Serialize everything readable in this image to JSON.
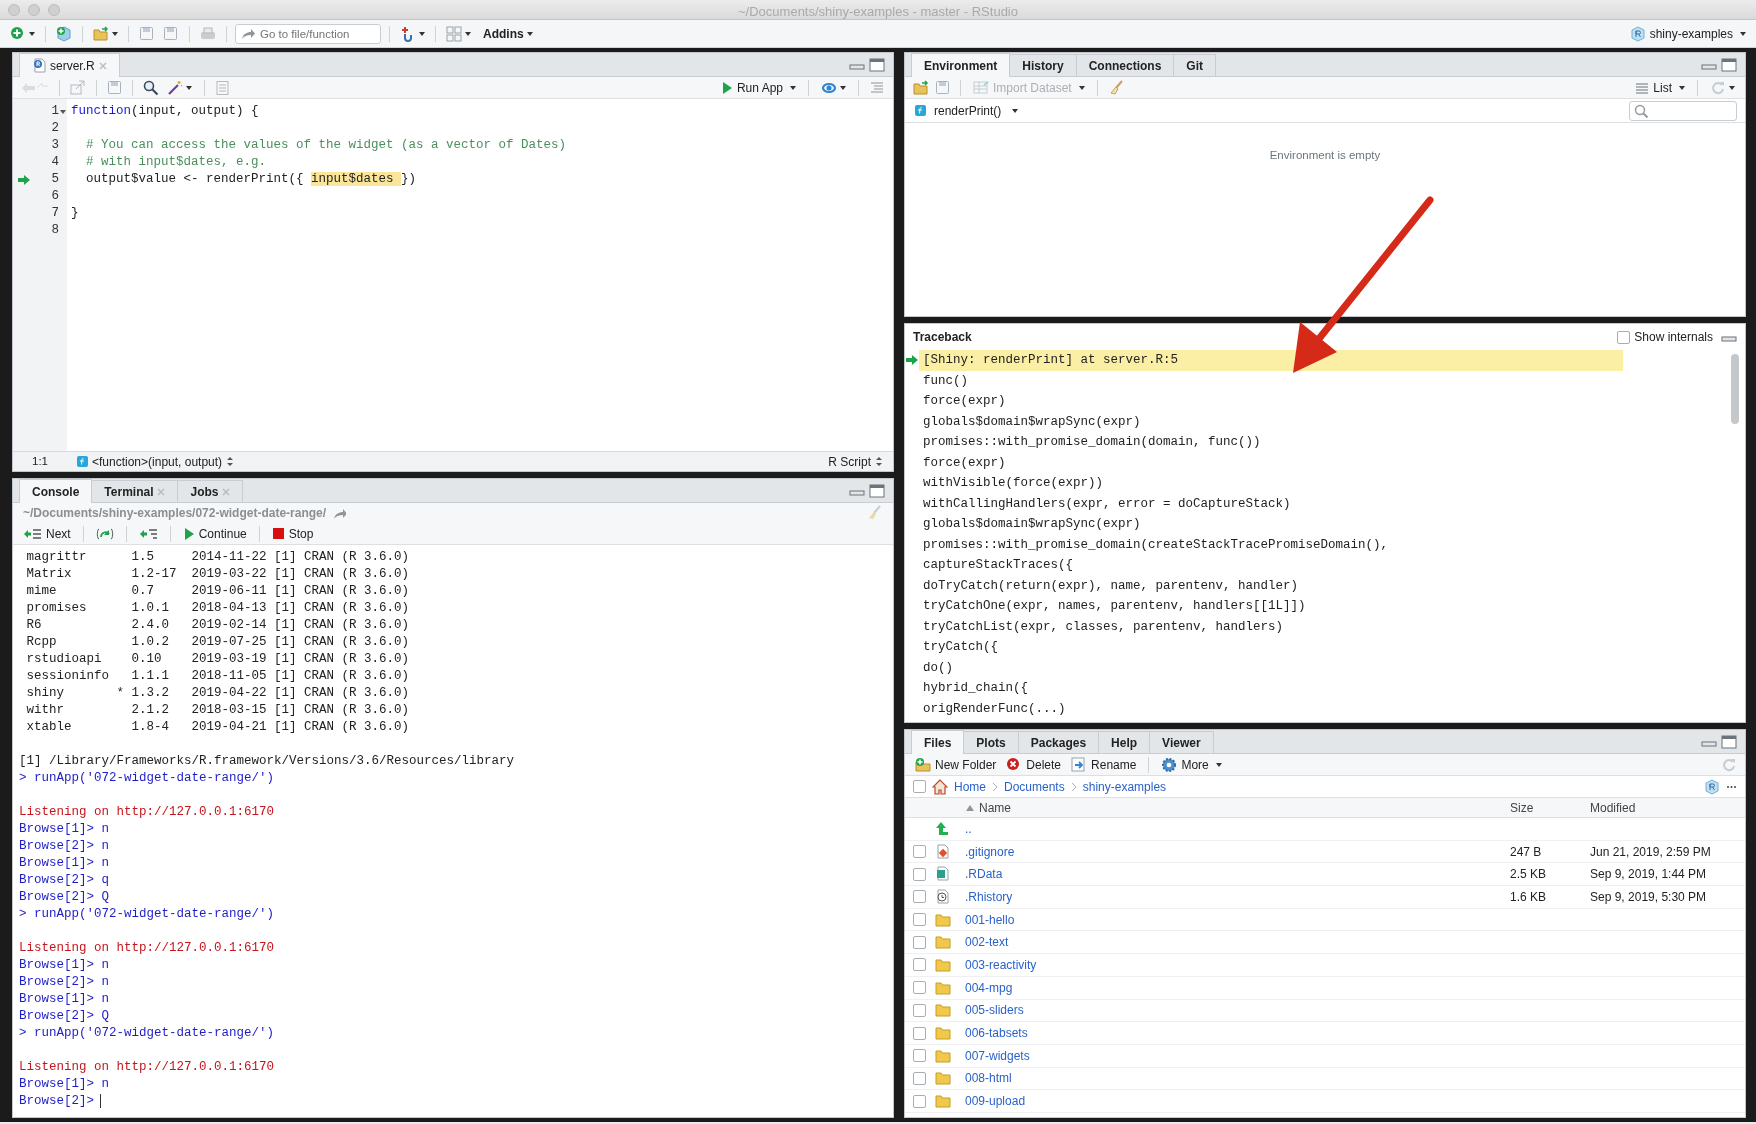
{
  "window": {
    "title": "~/Documents/shiny-examples - master - RStudio"
  },
  "toolbar": {
    "goto_placeholder": "Go to file/function",
    "addins": "Addins",
    "project": "shiny-examples"
  },
  "editor": {
    "tabs": [
      {
        "label": "server.R",
        "selected": true
      }
    ],
    "run_app": "Run App",
    "lines": [
      {
        "number": "1",
        "foldable": true,
        "current": false,
        "segments": [
          {
            "kind": "keyword",
            "text": "function"
          },
          {
            "kind": "code",
            "text": "(input, output) {"
          }
        ]
      },
      {
        "number": "2",
        "foldable": false,
        "current": false
      },
      {
        "number": "3",
        "foldable": false,
        "current": false,
        "segments": [
          {
            "kind": "comment",
            "text": "  # You can access the values of the widget (as a vector of Dates)"
          }
        ]
      },
      {
        "number": "4",
        "foldable": false,
        "current": false,
        "segments": [
          {
            "kind": "comment",
            "text": "  # with input$dates, e.g."
          }
        ]
      },
      {
        "number": "5",
        "foldable": false,
        "current": true,
        "segments": [
          {
            "kind": "code",
            "text": "  output$value <- renderPrint({ "
          },
          {
            "kind": "highlight",
            "text": "input$dates "
          },
          {
            "kind": "code",
            "text": "})"
          }
        ]
      },
      {
        "number": "6",
        "foldable": false,
        "current": false
      },
      {
        "number": "7",
        "foldable": false,
        "current": false,
        "segments": [
          {
            "kind": "code",
            "text": "}"
          }
        ]
      },
      {
        "number": "8",
        "foldable": false,
        "current": false
      }
    ],
    "status": {
      "position": "1:1",
      "scope": "<function>(input, output)",
      "file_type": "R Script"
    }
  },
  "console": {
    "tabs": [
      {
        "label": "Console",
        "selected": true,
        "closable": false
      },
      {
        "label": "Terminal",
        "selected": false,
        "closable": true
      },
      {
        "label": "Jobs",
        "selected": false,
        "closable": true
      }
    ],
    "path": "~/Documents/shiny-examples/072-widget-date-range/",
    "debug_buttons": [
      {
        "kind": "next",
        "label": "Next"
      },
      {
        "kind": "step-into"
      },
      {
        "kind": "finish"
      },
      {
        "kind": "continue",
        "label": "Continue"
      },
      {
        "kind": "stop",
        "label": "Stop"
      }
    ],
    "lines": [
      {
        "kind": "output",
        "text": " magrittr      1.5     2014-11-22 [1] CRAN (R 3.6.0)"
      },
      {
        "kind": "output",
        "text": " Matrix        1.2-17  2019-03-22 [1] CRAN (R 3.6.0)"
      },
      {
        "kind": "output",
        "text": " mime          0.7     2019-06-11 [1] CRAN (R 3.6.0)"
      },
      {
        "kind": "output",
        "text": " promises      1.0.1   2018-04-13 [1] CRAN (R 3.6.0)"
      },
      {
        "kind": "output",
        "text": " R6            2.4.0   2019-02-14 [1] CRAN (R 3.6.0)"
      },
      {
        "kind": "output",
        "text": " Rcpp          1.0.2   2019-07-25 [1] CRAN (R 3.6.0)"
      },
      {
        "kind": "output",
        "text": " rstudioapi    0.10    2019-03-19 [1] CRAN (R 3.6.0)"
      },
      {
        "kind": "output",
        "text": " sessioninfo   1.1.1   2018-11-05 [1] CRAN (R 3.6.0)"
      },
      {
        "kind": "output",
        "text": " shiny       * 1.3.2   2019-04-22 [1] CRAN (R 3.6.0)"
      },
      {
        "kind": "output",
        "text": " withr         2.1.2   2018-03-15 [1] CRAN (R 3.6.0)"
      },
      {
        "kind": "output",
        "text": " xtable        1.8-4   2019-04-21 [1] CRAN (R 3.6.0)"
      },
      {
        "kind": "blank"
      },
      {
        "kind": "output",
        "text": "[1] /Library/Frameworks/R.framework/Versions/3.6/Resources/library"
      },
      {
        "kind": "command",
        "text": "> runApp('072-widget-date-range/')"
      },
      {
        "kind": "blank"
      },
      {
        "kind": "message",
        "text": "Listening on http://127.0.0.1:6170"
      },
      {
        "kind": "command",
        "text": "Browse[1]> n"
      },
      {
        "kind": "command",
        "text": "Browse[2]> n"
      },
      {
        "kind": "command",
        "text": "Browse[1]> n"
      },
      {
        "kind": "command",
        "text": "Browse[2]> q"
      },
      {
        "kind": "command",
        "text": "Browse[2]> Q"
      },
      {
        "kind": "command",
        "text": "> runApp('072-widget-date-range/')"
      },
      {
        "kind": "blank"
      },
      {
        "kind": "message",
        "text": "Listening on http://127.0.0.1:6170"
      },
      {
        "kind": "command",
        "text": "Browse[1]> n"
      },
      {
        "kind": "command",
        "text": "Browse[2]> n"
      },
      {
        "kind": "command",
        "text": "Browse[1]> n"
      },
      {
        "kind": "command",
        "text": "Browse[2]> Q"
      },
      {
        "kind": "command",
        "text": "> runApp('072-widget-date-range/')"
      },
      {
        "kind": "blank"
      },
      {
        "kind": "message",
        "text": "Listening on http://127.0.0.1:6170"
      },
      {
        "kind": "command",
        "text": "Browse[1]> n"
      },
      {
        "kind": "input",
        "text": "Browse[2]>"
      }
    ]
  },
  "environment": {
    "tabs": [
      {
        "label": "Environment",
        "selected": true
      },
      {
        "label": "History",
        "selected": false
      },
      {
        "label": "Connections",
        "selected": false
      },
      {
        "label": "Git",
        "selected": false
      }
    ],
    "import_dataset": "Import Dataset",
    "view": "List",
    "frame": "renderPrint()",
    "empty_message": "Environment is empty"
  },
  "traceback": {
    "title": "Traceback",
    "show_internals": {
      "label": "Show internals",
      "checked": false
    },
    "frames": [
      {
        "text": "[Shiny: renderPrint] at server.R:5",
        "selected": true
      },
      {
        "text": "func()",
        "selected": false
      },
      {
        "text": "force(expr)",
        "selected": false
      },
      {
        "text": "globals$domain$wrapSync(expr)",
        "selected": false
      },
      {
        "text": "promises::with_promise_domain(domain, func())",
        "selected": false
      },
      {
        "text": "force(expr)",
        "selected": false
      },
      {
        "text": "withVisible(force(expr))",
        "selected": false
      },
      {
        "text": "withCallingHandlers(expr, error = doCaptureStack)",
        "selected": false
      },
      {
        "text": "globals$domain$wrapSync(expr)",
        "selected": false
      },
      {
        "text": "promises::with_promise_domain(createStackTracePromiseDomain(),",
        "selected": false
      },
      {
        "text": "captureStackTraces({",
        "selected": false
      },
      {
        "text": "doTryCatch(return(expr), name, parentenv, handler)",
        "selected": false
      },
      {
        "text": "tryCatchOne(expr, names, parentenv, handlers[[1L]])",
        "selected": false
      },
      {
        "text": "tryCatchList(expr, classes, parentenv, handlers)",
        "selected": false
      },
      {
        "text": "tryCatch({",
        "selected": false
      },
      {
        "text": "do()",
        "selected": false
      },
      {
        "text": "hybrid_chain({",
        "selected": false
      },
      {
        "text": "origRenderFunc(...)",
        "selected": false
      }
    ]
  },
  "files": {
    "tabs": [
      {
        "label": "Files",
        "selected": true
      },
      {
        "label": "Plots",
        "selected": false
      },
      {
        "label": "Packages",
        "selected": false
      },
      {
        "label": "Help",
        "selected": false
      },
      {
        "label": "Viewer",
        "selected": false
      }
    ],
    "actions": [
      {
        "kind": "new-folder",
        "label": "New Folder"
      },
      {
        "kind": "delete",
        "label": "Delete"
      },
      {
        "kind": "rename",
        "label": "Rename"
      },
      {
        "kind": "more",
        "label": "More"
      }
    ],
    "select_all": {
      "checked": false
    },
    "breadcrumb": [
      "Home",
      "Documents",
      "shiny-examples"
    ],
    "columns": [
      "Name",
      "Size",
      "Modified"
    ],
    "rows": [
      {
        "kind": "up",
        "name": ".."
      },
      {
        "kind": "git",
        "name": ".gitignore",
        "size": "247 B",
        "modified": "Jun 21, 2019, 2:59 PM",
        "checked": false
      },
      {
        "kind": "rdata",
        "name": ".RData",
        "size": "2.5 KB",
        "modified": "Sep 9, 2019, 1:44 PM",
        "checked": false
      },
      {
        "kind": "history",
        "name": ".Rhistory",
        "size": "1.6 KB",
        "modified": "Sep 9, 2019, 5:30 PM",
        "checked": false
      },
      {
        "kind": "folder",
        "name": "001-hello",
        "checked": false
      },
      {
        "kind": "folder",
        "name": "002-text",
        "checked": false
      },
      {
        "kind": "folder",
        "name": "003-reactivity",
        "checked": false
      },
      {
        "kind": "folder",
        "name": "004-mpg",
        "checked": false
      },
      {
        "kind": "folder",
        "name": "005-sliders",
        "checked": false
      },
      {
        "kind": "folder",
        "name": "006-tabsets",
        "checked": false
      },
      {
        "kind": "folder",
        "name": "007-widgets",
        "checked": false
      },
      {
        "kind": "folder",
        "name": "008-html",
        "checked": false
      },
      {
        "kind": "folder",
        "name": "009-upload",
        "checked": false
      }
    ]
  }
}
